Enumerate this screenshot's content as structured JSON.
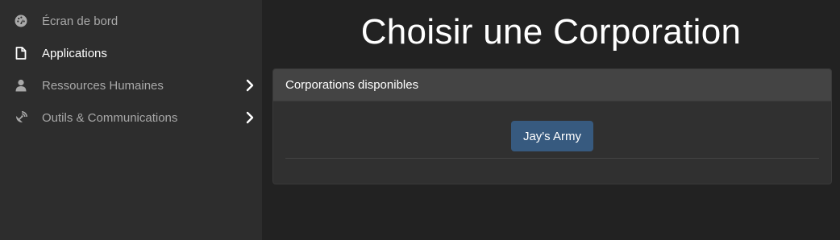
{
  "sidebar": {
    "items": [
      {
        "label": "Écran de bord",
        "icon": "dashboard-icon",
        "active": false,
        "has_submenu": false
      },
      {
        "label": "Applications",
        "icon": "file-icon",
        "active": true,
        "has_submenu": false
      },
      {
        "label": "Ressources Humaines",
        "icon": "user-icon",
        "active": false,
        "has_submenu": true
      },
      {
        "label": "Outils & Communications",
        "icon": "satellite-dish-icon",
        "active": false,
        "has_submenu": true
      }
    ]
  },
  "main": {
    "title": "Choisir une Corporation",
    "panel": {
      "header": "Corporations disponibles",
      "corporations": [
        "Jay's Army"
      ]
    }
  },
  "colors": {
    "sidebar_bg": "#2d2d2d",
    "page_bg": "#222222",
    "panel_bg": "#303030",
    "panel_header_bg": "#444444",
    "button_bg": "#375a7f",
    "text_primary": "#ffffff",
    "text_muted": "#a9a9a9"
  }
}
